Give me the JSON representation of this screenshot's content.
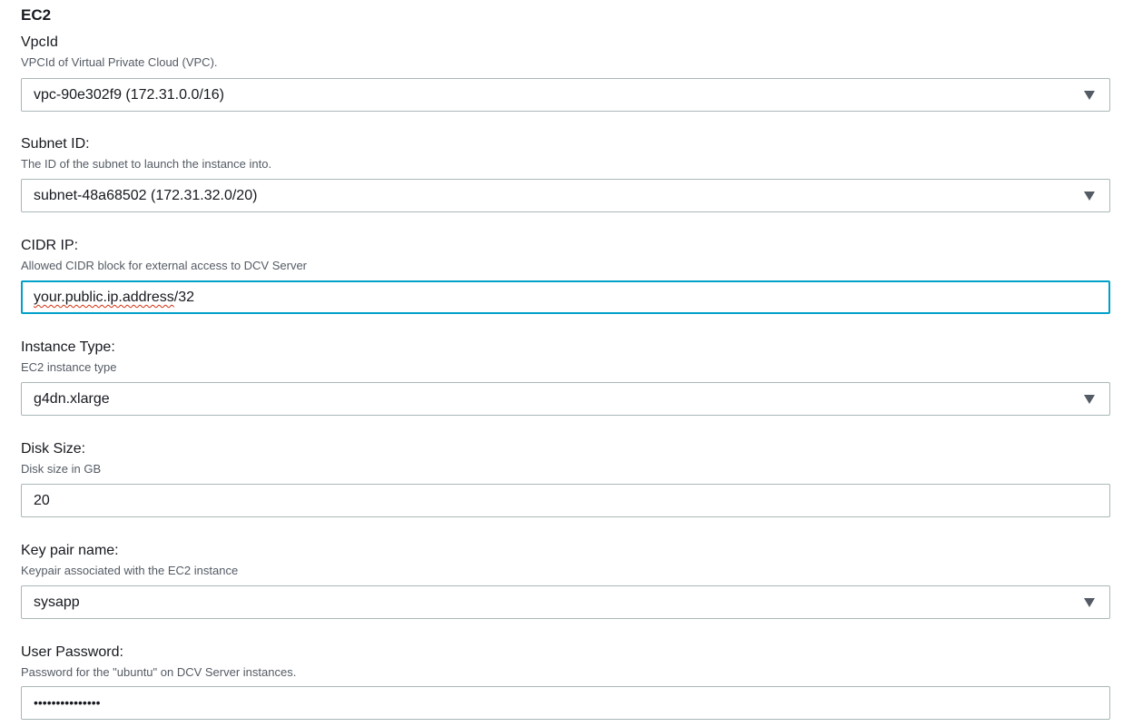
{
  "section": {
    "title": "EC2"
  },
  "fields": {
    "vpc": {
      "label": "VpcId",
      "description": "VPCId of Virtual Private Cloud (VPC).",
      "value": "vpc-90e302f9 (172.31.0.0/16)"
    },
    "subnet": {
      "label": "Subnet ID:",
      "description": "The ID of the subnet to launch the instance into.",
      "value": "subnet-48a68502 (172.31.32.0/20)"
    },
    "cidr": {
      "label": "CIDR IP:",
      "description": "Allowed CIDR block for external access to DCV Server",
      "value_misspelled": "your.public.ip.address",
      "value_rest": "/32"
    },
    "instance_type": {
      "label": "Instance Type:",
      "description": "EC2 instance type",
      "value": "g4dn.xlarge"
    },
    "disk_size": {
      "label": "Disk Size:",
      "description": "Disk size in GB",
      "value": "20"
    },
    "key_pair": {
      "label": "Key pair name:",
      "description": "Keypair associated with the EC2 instance",
      "value": "sysapp"
    },
    "password": {
      "label": "User Password:",
      "description": "Password for the \"ubuntu\" on DCV Server instances.",
      "value_masked": "•••••••••••••••"
    }
  },
  "icons": {
    "dropdown": "caret-down-icon"
  },
  "colors": {
    "focus_border": "#00a1c9",
    "border": "#aab7b8",
    "description_text": "#545b64",
    "spellcheck": "#d13212"
  }
}
